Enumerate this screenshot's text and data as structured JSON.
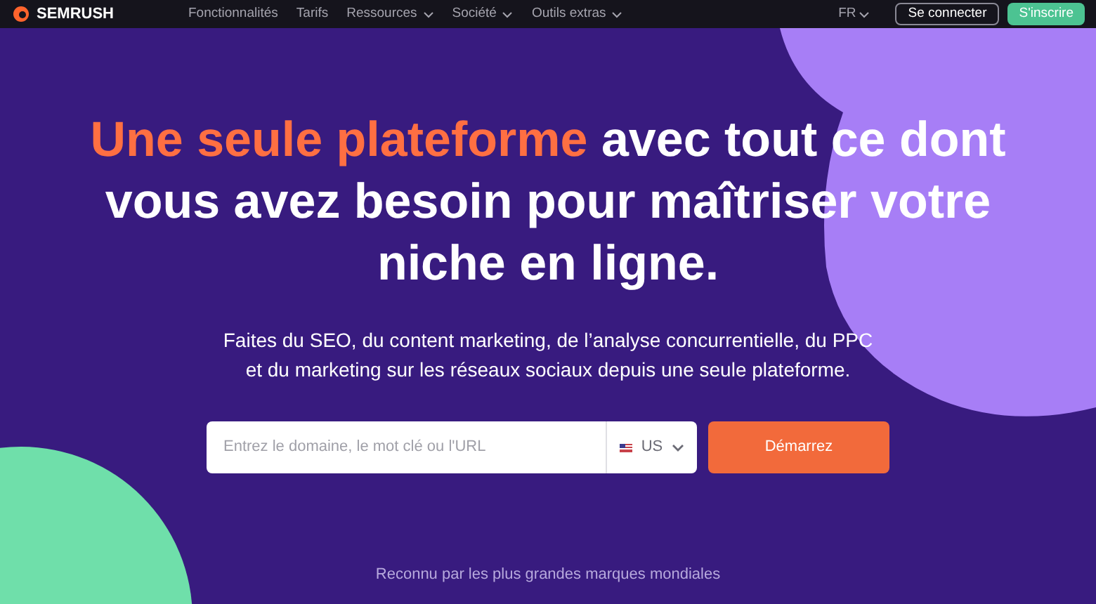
{
  "nav": {
    "brand": "SEMRUSH",
    "items": [
      {
        "label": "Fonctionnalités",
        "dropdown": false
      },
      {
        "label": "Tarifs",
        "dropdown": false
      },
      {
        "label": "Ressources",
        "dropdown": true
      },
      {
        "label": "Société",
        "dropdown": true
      },
      {
        "label": "Outils extras",
        "dropdown": true
      }
    ],
    "language": "FR",
    "login": "Se connecter",
    "signup": "S'inscrire"
  },
  "hero": {
    "headline_accent": "Une seule plateforme",
    "headline_rest": " avec tout ce dont vous avez besoin pour maîtriser votre niche en ligne.",
    "subtitle": "Faites du SEO, du content marketing, de l’analyse concurrentielle, du PPC et du marketing sur les réseaux sociaux depuis une seule plateforme.",
    "search": {
      "placeholder": "Entrez le domaine, le mot clé ou l'URL",
      "country": "US",
      "button": "Démarrez"
    },
    "trust_text": "Reconnu par les plus grandes marques mondiales"
  }
}
